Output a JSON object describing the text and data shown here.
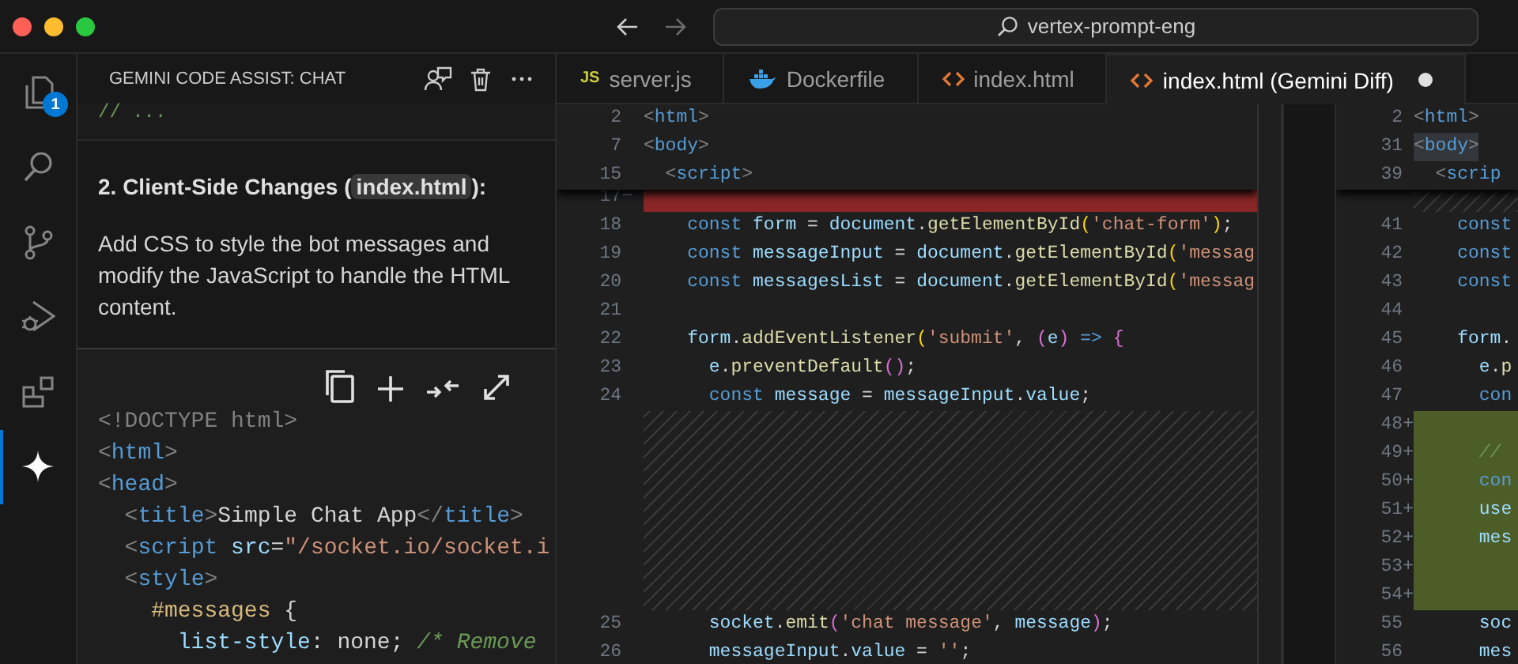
{
  "title_bar": {
    "search": "vertex-prompt-eng"
  },
  "activity_bar": [
    {
      "kind": "files",
      "selected": false,
      "badge": "1"
    },
    {
      "kind": "search",
      "selected": false
    },
    {
      "kind": "source-control",
      "selected": false
    },
    {
      "kind": "run-debug",
      "selected": false
    },
    {
      "kind": "extensions",
      "selected": false
    },
    {
      "kind": "gemini",
      "selected": true
    }
  ],
  "chat": {
    "title": "GEMINI CODE ASSIST: CHAT",
    "previous_code": "// ...",
    "heading": [
      {
        "kind": "text",
        "text": "2. Client-Side Changes ("
      },
      {
        "kind": "code",
        "text": "index.html"
      },
      {
        "kind": "text",
        "text": "):"
      }
    ],
    "paragraph": "Add CSS to style the bot messages and modify the JavaScript to handle the HTML content.",
    "code_block": [
      [
        {
          "kind": "br",
          "text": "<!DOCTYPE html>"
        }
      ],
      [
        {
          "kind": "br",
          "text": "<"
        },
        {
          "kind": "tag",
          "text": "html"
        },
        {
          "kind": "br",
          "text": ">"
        }
      ],
      [
        {
          "kind": "br",
          "text": "<"
        },
        {
          "kind": "tag",
          "text": "head"
        },
        {
          "kind": "br",
          "text": ">"
        }
      ],
      [
        {
          "kind": "br",
          "text": "  <"
        },
        {
          "kind": "tag",
          "text": "title"
        },
        {
          "kind": "br",
          "text": ">"
        },
        {
          "kind": "t",
          "text": "Simple Chat App"
        },
        {
          "kind": "br",
          "text": "</"
        },
        {
          "kind": "tag",
          "text": "title"
        },
        {
          "kind": "br",
          "text": ">"
        }
      ],
      [
        {
          "kind": "br",
          "text": "  <"
        },
        {
          "kind": "tag",
          "text": "script"
        },
        {
          "kind": "attr",
          "text": " src"
        },
        {
          "kind": "t",
          "text": "="
        },
        {
          "kind": "str",
          "text": "\"/socket.io/socket.i"
        }
      ],
      [
        {
          "kind": "br",
          "text": "  <"
        },
        {
          "kind": "tag",
          "text": "style"
        },
        {
          "kind": "br",
          "text": ">"
        }
      ],
      [
        {
          "kind": "sel",
          "text": "    #messages"
        },
        {
          "kind": "t",
          "text": " {"
        }
      ],
      [
        {
          "kind": "attr",
          "text": "      list-style"
        },
        {
          "kind": "t",
          "text": ": none; "
        },
        {
          "kind": "cm",
          "text": "/* Remove"
        }
      ]
    ]
  },
  "tabs": [
    {
      "label": "server.js",
      "kind": "js",
      "icon_text": "JS",
      "selected": false,
      "modified": false
    },
    {
      "label": "Dockerfile",
      "kind": "docker",
      "selected": false,
      "modified": false
    },
    {
      "label": "index.html",
      "kind": "html",
      "selected": false,
      "modified": false
    },
    {
      "label": "index.html (Gemini Diff)",
      "kind": "html",
      "selected": true,
      "modified": true
    }
  ],
  "diff": {
    "left": {
      "sticky": [
        {
          "num": "2",
          "tokens": [
            {
              "kind": "br",
              "text": "<"
            },
            {
              "kind": "tag",
              "text": "html"
            },
            {
              "kind": "br",
              "text": ">"
            }
          ]
        },
        {
          "num": "7",
          "tokens": [
            {
              "kind": "br",
              "text": "<"
            },
            {
              "kind": "tag",
              "text": "body"
            },
            {
              "kind": "br",
              "text": ">"
            }
          ]
        },
        {
          "num": "15",
          "tokens": [
            {
              "kind": "br",
              "text": "  <"
            },
            {
              "kind": "tag",
              "text": "script"
            },
            {
              "kind": "br",
              "text": ">"
            }
          ]
        }
      ],
      "lines": [
        {
          "num": "17−",
          "kind": "removed"
        },
        {
          "num": "18",
          "kind": "normal",
          "tokens": [
            {
              "kind": "kw",
              "text": "    const"
            },
            {
              "kind": "var",
              "text": " form"
            },
            {
              "kind": "t",
              "text": " = "
            },
            {
              "kind": "var",
              "text": "document"
            },
            {
              "kind": "t",
              "text": "."
            },
            {
              "kind": "fn",
              "text": "getElementById"
            },
            {
              "kind": "y",
              "text": "("
            },
            {
              "kind": "str",
              "text": "'chat-form'"
            },
            {
              "kind": "y",
              "text": ")"
            },
            {
              "kind": "t",
              "text": ";"
            }
          ]
        },
        {
          "num": "19",
          "kind": "normal",
          "tokens": [
            {
              "kind": "kw",
              "text": "    const"
            },
            {
              "kind": "var",
              "text": " messageInput"
            },
            {
              "kind": "t",
              "text": " = "
            },
            {
              "kind": "var",
              "text": "document"
            },
            {
              "kind": "t",
              "text": "."
            },
            {
              "kind": "fn",
              "text": "getElementById"
            },
            {
              "kind": "y",
              "text": "("
            },
            {
              "kind": "str",
              "text": "'messag"
            }
          ]
        },
        {
          "num": "20",
          "kind": "normal",
          "tokens": [
            {
              "kind": "kw",
              "text": "    const"
            },
            {
              "kind": "var",
              "text": " messagesList"
            },
            {
              "kind": "t",
              "text": " = "
            },
            {
              "kind": "var",
              "text": "document"
            },
            {
              "kind": "t",
              "text": "."
            },
            {
              "kind": "fn",
              "text": "getElementById"
            },
            {
              "kind": "y",
              "text": "("
            },
            {
              "kind": "str",
              "text": "'messag"
            }
          ]
        },
        {
          "num": "21",
          "kind": "normal"
        },
        {
          "num": "22",
          "kind": "normal",
          "tokens": [
            {
              "kind": "var",
              "text": "    form"
            },
            {
              "kind": "t",
              "text": "."
            },
            {
              "kind": "fn",
              "text": "addEventListener"
            },
            {
              "kind": "y",
              "text": "("
            },
            {
              "kind": "str",
              "text": "'submit'"
            },
            {
              "kind": "t",
              "text": ", "
            },
            {
              "kind": "m",
              "text": "("
            },
            {
              "kind": "var",
              "text": "e"
            },
            {
              "kind": "m",
              "text": ")"
            },
            {
              "kind": "kw",
              "text": " =>"
            },
            {
              "kind": "m",
              "text": " {"
            }
          ]
        },
        {
          "num": "23",
          "kind": "normal",
          "tokens": [
            {
              "kind": "var",
              "text": "      e"
            },
            {
              "kind": "t",
              "text": "."
            },
            {
              "kind": "fn",
              "text": "preventDefault"
            },
            {
              "kind": "m",
              "text": "()"
            },
            {
              "kind": "t",
              "text": ";"
            }
          ]
        },
        {
          "num": "24",
          "kind": "normal",
          "tokens": [
            {
              "kind": "kw",
              "text": "      const"
            },
            {
              "kind": "var",
              "text": " message"
            },
            {
              "kind": "t",
              "text": " = "
            },
            {
              "kind": "var",
              "text": "messageInput"
            },
            {
              "kind": "t",
              "text": "."
            },
            {
              "kind": "var",
              "text": "value"
            },
            {
              "kind": "t",
              "text": ";"
            }
          ]
        },
        {
          "kind": "spacer"
        },
        {
          "kind": "spacer"
        },
        {
          "kind": "spacer"
        },
        {
          "kind": "spacer"
        },
        {
          "kind": "spacer"
        },
        {
          "kind": "spacer"
        },
        {
          "kind": "spacer"
        },
        {
          "num": "25",
          "kind": "normal",
          "tokens": [
            {
              "kind": "var",
              "text": "      socket"
            },
            {
              "kind": "t",
              "text": "."
            },
            {
              "kind": "fn",
              "text": "emit"
            },
            {
              "kind": "m",
              "text": "("
            },
            {
              "kind": "str",
              "text": "'chat message'"
            },
            {
              "kind": "t",
              "text": ", "
            },
            {
              "kind": "var",
              "text": "message"
            },
            {
              "kind": "m",
              "text": ")"
            },
            {
              "kind": "t",
              "text": ";"
            }
          ]
        },
        {
          "num": "26",
          "kind": "normal",
          "tokens": [
            {
              "kind": "var",
              "text": "      messageInput"
            },
            {
              "kind": "t",
              "text": "."
            },
            {
              "kind": "var",
              "text": "value"
            },
            {
              "kind": "t",
              "text": " = "
            },
            {
              "kind": "str",
              "text": "''"
            },
            {
              "kind": "t",
              "text": ";"
            }
          ]
        }
      ]
    },
    "right": {
      "sticky": [
        {
          "num": "2",
          "highlighted": false,
          "tokens": [
            {
              "kind": "br",
              "text": "<"
            },
            {
              "kind": "tag",
              "text": "html"
            },
            {
              "kind": "br",
              "text": ">"
            }
          ]
        },
        {
          "num": "31",
          "highlighted": true,
          "tokens": [
            {
              "kind": "br",
              "text": "<"
            },
            {
              "kind": "tag",
              "text": "body"
            },
            {
              "kind": "br",
              "text": ">"
            }
          ]
        },
        {
          "num": "39",
          "highlighted": false,
          "tokens": [
            {
              "kind": "br",
              "text": "  <"
            },
            {
              "kind": "tag",
              "text": "scrip"
            }
          ]
        }
      ],
      "lines": [
        {
          "kind": "spacer"
        },
        {
          "num": "41",
          "kind": "normal",
          "tokens": [
            {
              "kind": "kw",
              "text": "    const"
            }
          ]
        },
        {
          "num": "42",
          "kind": "normal",
          "tokens": [
            {
              "kind": "kw",
              "text": "    const"
            }
          ]
        },
        {
          "num": "43",
          "kind": "normal",
          "tokens": [
            {
              "kind": "kw",
              "text": "    const"
            }
          ]
        },
        {
          "num": "44",
          "kind": "normal"
        },
        {
          "num": "45",
          "kind": "normal",
          "tokens": [
            {
              "kind": "var",
              "text": "    form"
            },
            {
              "kind": "t",
              "text": "."
            }
          ]
        },
        {
          "num": "46",
          "kind": "normal",
          "tokens": [
            {
              "kind": "var",
              "text": "      e"
            },
            {
              "kind": "t",
              "text": "."
            },
            {
              "kind": "fn",
              "text": "p"
            }
          ]
        },
        {
          "num": "47",
          "kind": "normal",
          "tokens": [
            {
              "kind": "kw",
              "text": "      con"
            }
          ]
        },
        {
          "num": "48+",
          "kind": "added"
        },
        {
          "num": "49+",
          "kind": "added",
          "tokens": [
            {
              "kind": "cm",
              "text": "      //"
            }
          ]
        },
        {
          "num": "50+",
          "kind": "added",
          "tokens": [
            {
              "kind": "kw",
              "text": "      con"
            }
          ]
        },
        {
          "num": "51+",
          "kind": "added",
          "tokens": [
            {
              "kind": "var",
              "text": "      use"
            }
          ]
        },
        {
          "num": "52+",
          "kind": "added",
          "tokens": [
            {
              "kind": "var",
              "text": "      mes"
            }
          ]
        },
        {
          "num": "53+",
          "kind": "added"
        },
        {
          "num": "54+",
          "kind": "added"
        },
        {
          "num": "55",
          "kind": "normal",
          "tokens": [
            {
              "kind": "var",
              "text": "      soc"
            }
          ]
        },
        {
          "num": "56",
          "kind": "normal",
          "tokens": [
            {
              "kind": "var",
              "text": "      mes"
            }
          ]
        }
      ]
    }
  }
}
